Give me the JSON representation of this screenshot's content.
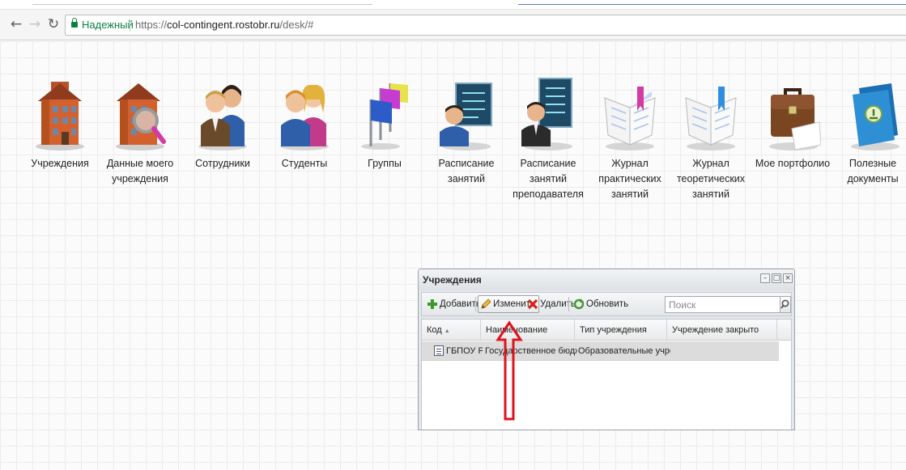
{
  "browser": {
    "security_label": "Надежный",
    "url_scheme": "https://",
    "url_host": "col-contingent.rostobr.ru",
    "url_path": "/desk/#",
    "back_icon": "arrow-left-icon",
    "forward_icon": "arrow-right-icon",
    "reload_icon": "reload-icon"
  },
  "desktop": {
    "icons": [
      {
        "label": "Учреждения",
        "icon": "building-icon"
      },
      {
        "label": "Данные моего учреждения",
        "icon": "building-search-icon"
      },
      {
        "label": "Сотрудники",
        "icon": "staff-icon"
      },
      {
        "label": "Студенты",
        "icon": "students-icon"
      },
      {
        "label": "Группы",
        "icon": "flags-icon"
      },
      {
        "label": "Расписание занятий",
        "icon": "schedule-icon"
      },
      {
        "label": "Расписание занятий преподавателя",
        "icon": "teacher-schedule-icon"
      },
      {
        "label": "Журнал практических занятий",
        "icon": "practical-journal-icon"
      },
      {
        "label": "Журнал теоретических занятий",
        "icon": "theoretical-journal-icon"
      },
      {
        "label": "Мое портфолио",
        "icon": "briefcase-icon"
      },
      {
        "label": "Полезные документы",
        "icon": "folder-icon"
      }
    ]
  },
  "window": {
    "title": "Учреждения",
    "toolbar": {
      "add_label": "Добавить",
      "edit_label": "Изменить",
      "delete_label": "Удалить",
      "refresh_label": "Обновить",
      "search_placeholder": "Поиск"
    },
    "columns": [
      "Код",
      "Наименование",
      "Тип учреждения",
      "Учреждение закрыто"
    ],
    "rows": [
      {
        "code": "ГБПОУ Р...",
        "name": "Государственное бюджетное",
        "type": "Образовательные учрежден",
        "closed": ""
      }
    ]
  },
  "colors": {
    "secure_green": "#0b8043",
    "annotation_red": "#e0121d",
    "window_border": "#9aa3ad"
  }
}
